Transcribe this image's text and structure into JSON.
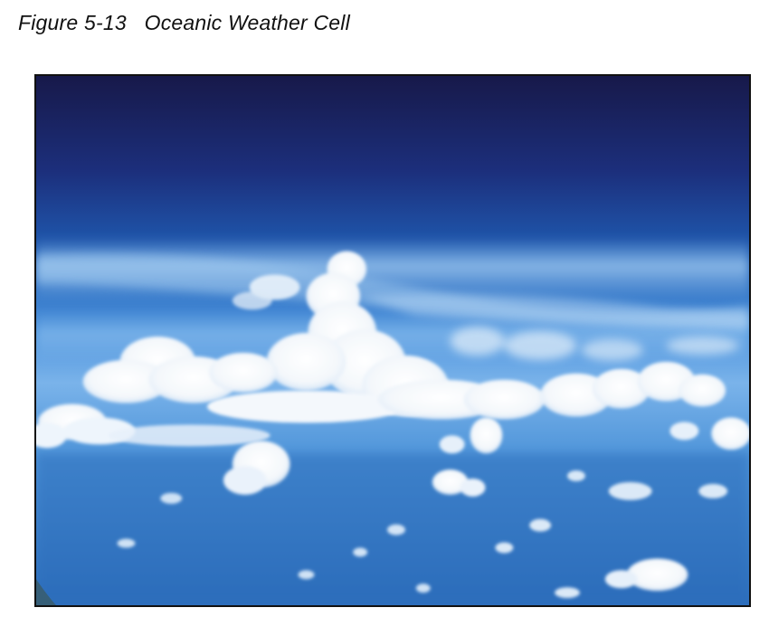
{
  "figure": {
    "label": "Figure 5-13",
    "title": "Oceanic Weather Cell"
  },
  "photo": {
    "subject": "oceanic weather cell",
    "colors": {
      "upper_sky": "#16184a",
      "mid_sky": "#1f5fb7",
      "horizon": "#78b3eb",
      "ocean": "#2e76c6",
      "cloud": "#ffffff"
    }
  }
}
